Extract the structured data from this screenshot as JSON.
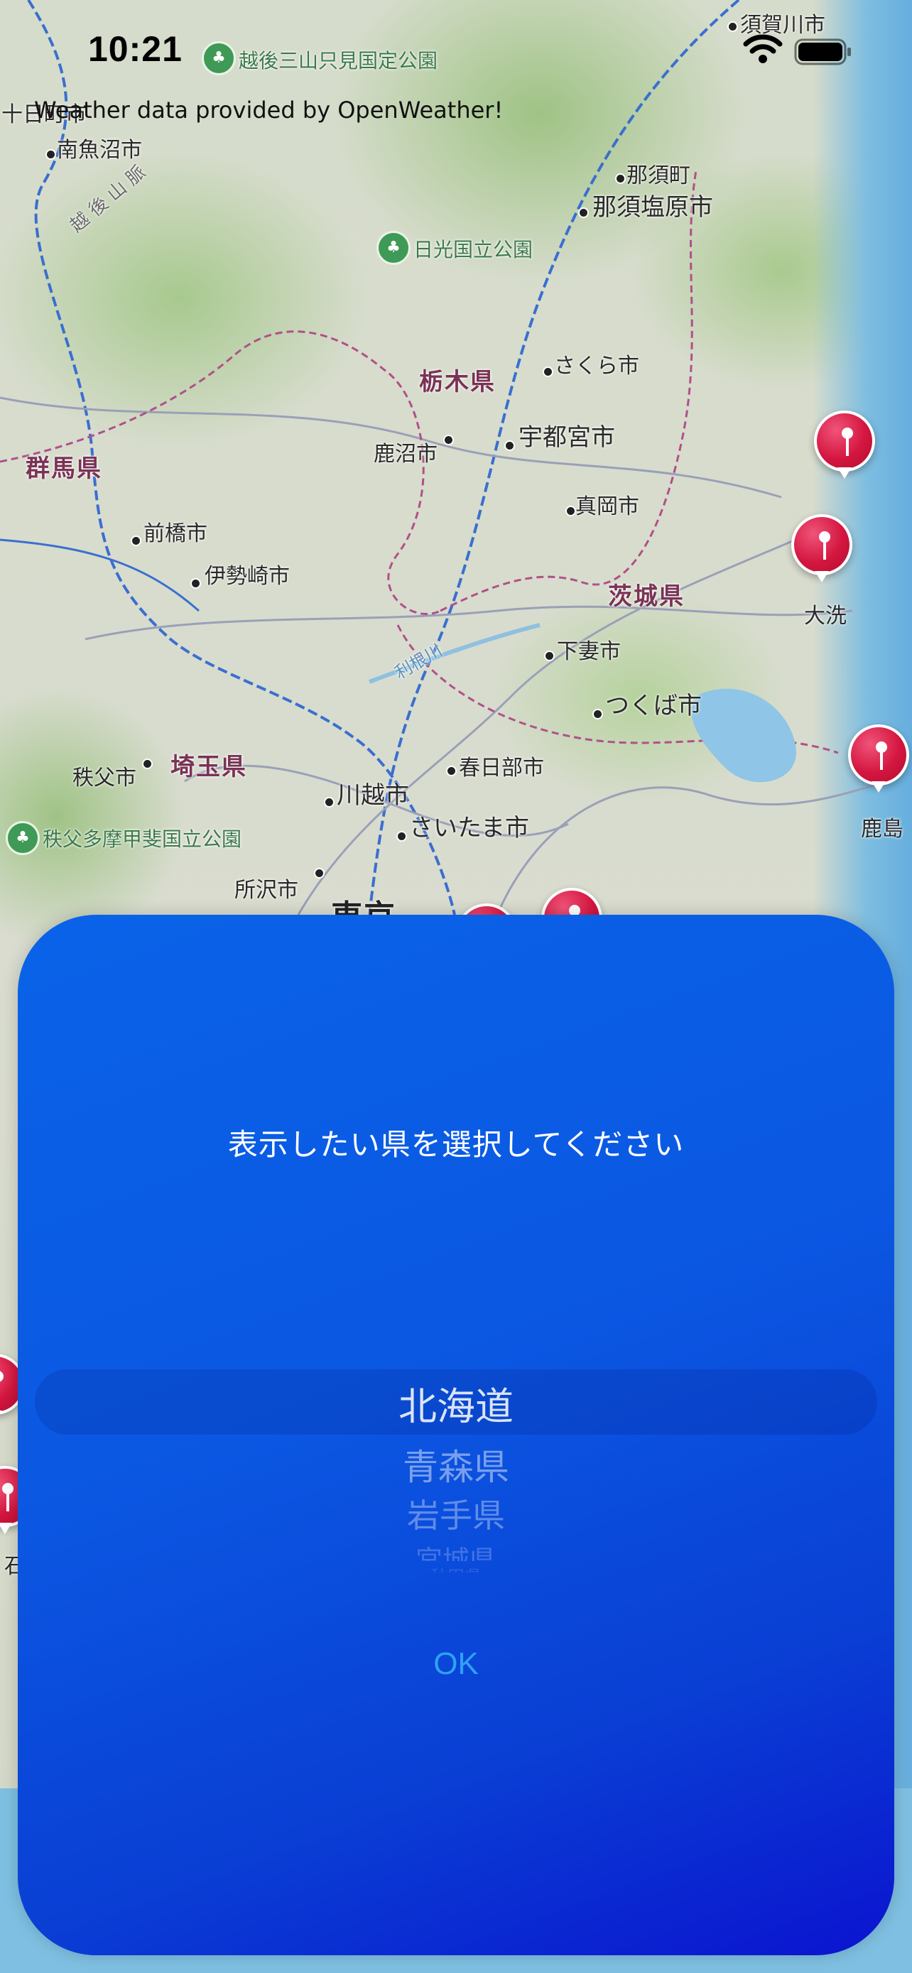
{
  "status_bar": {
    "time": "10:21"
  },
  "attribution": "Weather data provided by OpenWeather!",
  "map": {
    "cities": [
      {
        "id": "sukagawa",
        "label": "須賀川市"
      },
      {
        "id": "tokamachi",
        "label": "十日町市"
      },
      {
        "id": "minamiuonuma",
        "label": "南魚沼市"
      },
      {
        "id": "nasu",
        "label": "那須町"
      },
      {
        "id": "nasushiobara",
        "label": "那須塩原市"
      },
      {
        "id": "sakura",
        "label": "さくら市"
      },
      {
        "id": "kanuma",
        "label": "鹿沼市"
      },
      {
        "id": "utsunomiya",
        "label": "宇都宮市"
      },
      {
        "id": "mooka",
        "label": "真岡市"
      },
      {
        "id": "maebashi",
        "label": "前橋市"
      },
      {
        "id": "isesaki",
        "label": "伊勢崎市"
      },
      {
        "id": "shimotsuma",
        "label": "下妻市"
      },
      {
        "id": "tsukuba",
        "label": "つくば市"
      },
      {
        "id": "chichibu",
        "label": "秩父市"
      },
      {
        "id": "kasukabe",
        "label": "春日部市"
      },
      {
        "id": "kawagoe",
        "label": "川越市"
      },
      {
        "id": "saitama",
        "label": "さいたま市"
      },
      {
        "id": "tokorozawa",
        "label": "所沢市"
      },
      {
        "id": "oarai",
        "label": "大洗"
      },
      {
        "id": "kashima",
        "label": "鹿島"
      }
    ],
    "prefectures": {
      "tochigi": "栃木県",
      "gunma": "群馬県",
      "ibaraki": "茨城県",
      "saitama": "埼玉県",
      "tokyo": "東京"
    },
    "parks": {
      "echigo": "越後三山只見国定公園",
      "nikko": "日光国立公園",
      "chichibu": "秩父多摩甲斐国立公園"
    },
    "river": "利根川",
    "mountains": "越 後 山 脈",
    "edge_fragment": "石"
  },
  "picker_sheet": {
    "title": "表示したい県を選択してください",
    "options": [
      "北海道",
      "青森県",
      "岩手県",
      "宮城県",
      "秋田県"
    ],
    "selected": "北海道",
    "ok_label": "OK"
  },
  "colors": {
    "sheet_top": "#0a63e8",
    "sheet_bottom": "#0b14cf",
    "ok_text": "#2fa1f5",
    "pin": "#d4163f",
    "prefecture_label": "#7a3355"
  }
}
